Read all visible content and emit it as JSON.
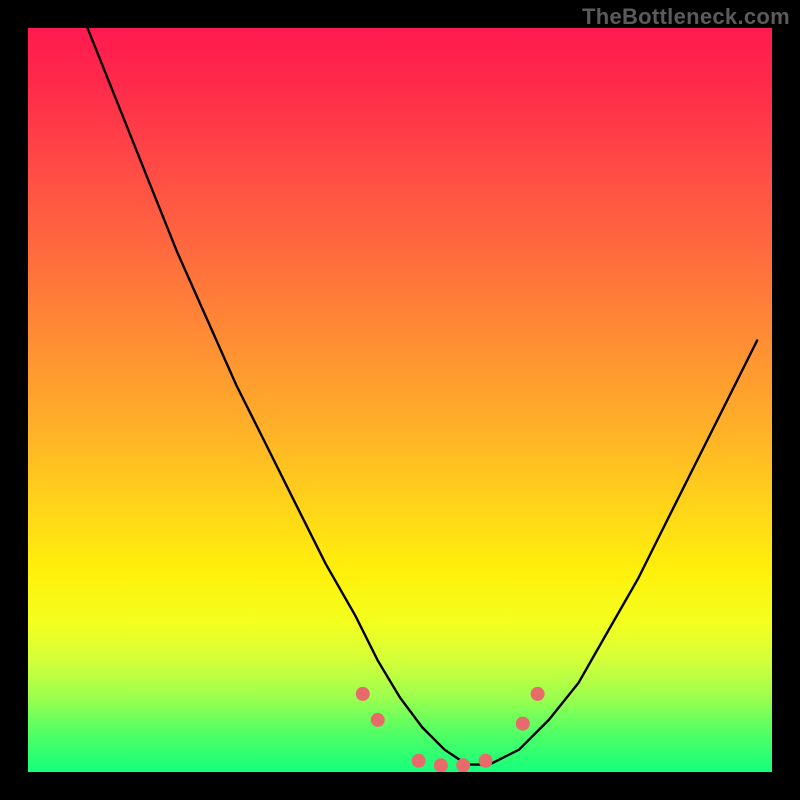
{
  "watermark": "TheBottleneck.com",
  "chart_data": {
    "type": "line",
    "title": "",
    "xlabel": "",
    "ylabel": "",
    "xlim": [
      0,
      100
    ],
    "ylim": [
      0,
      100
    ],
    "grid": false,
    "legend": false,
    "series": [
      {
        "name": "bottleneck-curve",
        "color": "#000000",
        "x": [
          8,
          12,
          16,
          20,
          24,
          28,
          32,
          36,
          40,
          44,
          47,
          50,
          53,
          56,
          59,
          62,
          66,
          70,
          74,
          78,
          82,
          86,
          90,
          94,
          98
        ],
        "y": [
          100,
          90,
          80,
          70,
          61,
          52,
          44,
          36,
          28,
          21,
          15,
          10,
          6,
          3,
          1,
          1,
          3,
          7,
          12,
          19,
          26,
          34,
          42,
          50,
          58
        ]
      }
    ],
    "markers": [
      {
        "name": "left-upper-dot",
        "x": 45.0,
        "y": 10.5
      },
      {
        "name": "left-lower-dot",
        "x": 47.0,
        "y": 7.0
      },
      {
        "name": "trough-dot-1",
        "x": 52.5,
        "y": 1.5
      },
      {
        "name": "trough-dot-2",
        "x": 55.5,
        "y": 0.9
      },
      {
        "name": "trough-dot-3",
        "x": 58.5,
        "y": 0.9
      },
      {
        "name": "trough-dot-4",
        "x": 61.5,
        "y": 1.5
      },
      {
        "name": "right-lower-dot",
        "x": 66.5,
        "y": 6.5
      },
      {
        "name": "right-upper-dot",
        "x": 68.5,
        "y": 10.5
      }
    ],
    "marker_color": "#e86a6a",
    "background_gradient": {
      "top": "#ff1a4f",
      "mid_upper": "#ff8d34",
      "mid_lower": "#fff00b",
      "bottom": "#14ff7c"
    }
  }
}
